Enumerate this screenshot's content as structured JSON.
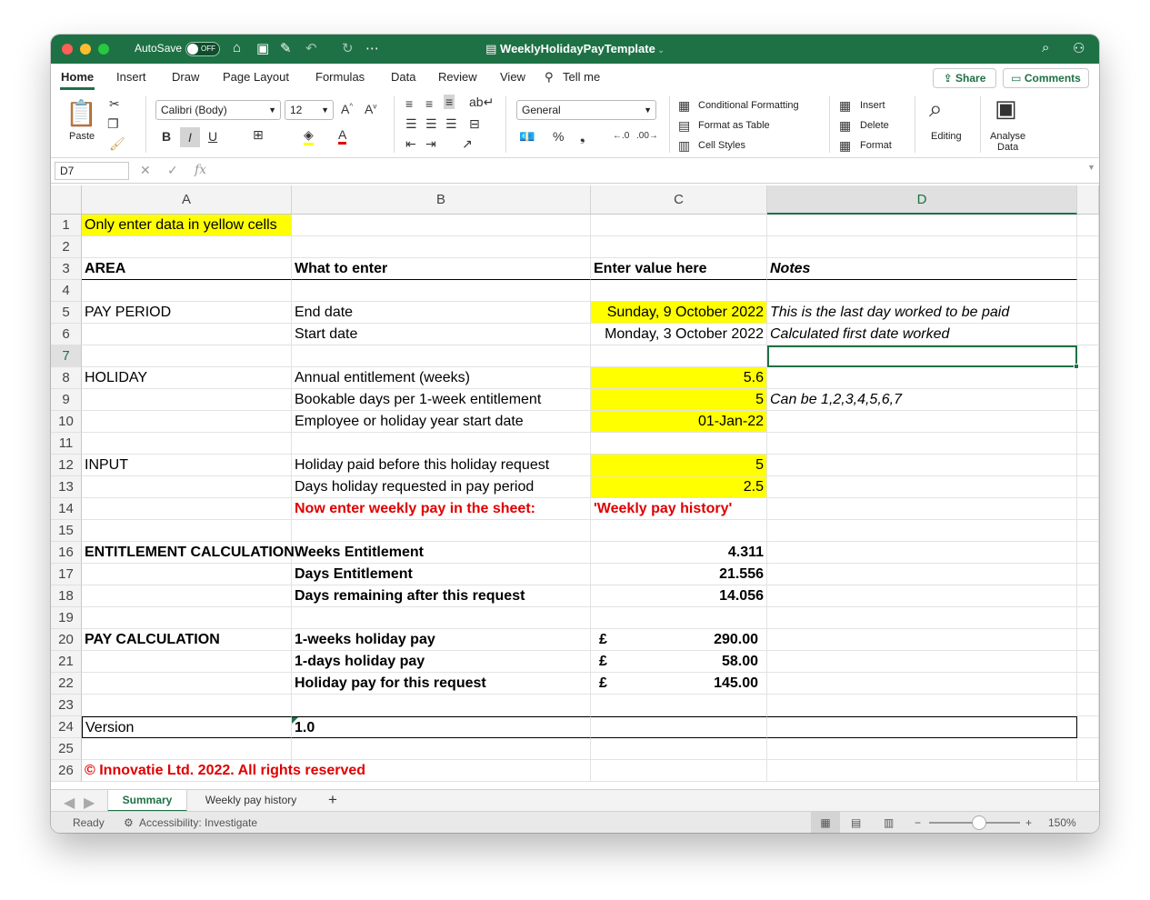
{
  "window": {
    "autosave_label": "AutoSave",
    "autosave_state": "OFF",
    "title": "WeeklyHolidayPayTemplate"
  },
  "tabs": [
    "Home",
    "Insert",
    "Draw",
    "Page Layout",
    "Formulas",
    "Data",
    "Review",
    "View",
    "Tell me"
  ],
  "buttons": {
    "share": "Share",
    "comments": "Comments"
  },
  "ribbon": {
    "paste": "Paste",
    "font_name": "Calibri (Body)",
    "font_size": "12",
    "number_format": "General",
    "conditional_formatting": "Conditional Formatting",
    "format_as_table": "Format as Table",
    "cell_styles": "Cell Styles",
    "insert": "Insert",
    "delete": "Delete",
    "format": "Format",
    "editing": "Editing",
    "analyse_data_1": "Analyse",
    "analyse_data_2": "Data"
  },
  "formula_bar": {
    "name_box": "D7",
    "fx": "fx",
    "formula": ""
  },
  "columns": [
    "A",
    "B",
    "C",
    "D"
  ],
  "rows": {
    "r1": {
      "num": "1",
      "A": "Only enter data in yellow cells"
    },
    "r2": {
      "num": "2"
    },
    "r3": {
      "num": "3",
      "A": "AREA",
      "B": "What to enter",
      "C": "Enter value here",
      "D": "Notes"
    },
    "r4": {
      "num": "4"
    },
    "r5": {
      "num": "5",
      "A": "PAY PERIOD",
      "B": "End date",
      "C": "Sunday, 9 October 2022",
      "D": "This is the last day worked to be paid"
    },
    "r6": {
      "num": "6",
      "B": "Start date",
      "C": "Monday, 3 October 2022",
      "D": "Calculated first date worked"
    },
    "r7": {
      "num": "7"
    },
    "r8": {
      "num": "8",
      "A": "HOLIDAY",
      "B": "Annual entitlement (weeks)",
      "C": "5.6"
    },
    "r9": {
      "num": "9",
      "B": "Bookable days per 1-week entitlement",
      "C": "5",
      "D": "Can be 1,2,3,4,5,6,7"
    },
    "r10": {
      "num": "10",
      "B": "Employee or holiday year start date",
      "C": "01-Jan-22"
    },
    "r11": {
      "num": "11"
    },
    "r12": {
      "num": "12",
      "A": "INPUT",
      "B": "Holiday paid before this holiday request",
      "C": "5"
    },
    "r13": {
      "num": "13",
      "B": "Days holiday requested in pay period",
      "C": "2.5"
    },
    "r14": {
      "num": "14",
      "B": "Now enter weekly pay in the sheet:",
      "C": "'Weekly pay history'"
    },
    "r15": {
      "num": "15"
    },
    "r16": {
      "num": "16",
      "A": "ENTITLEMENT CALCULATION",
      "B": "Weeks Entitlement",
      "C": "4.311"
    },
    "r17": {
      "num": "17",
      "B": "Days Entitlement",
      "C": "21.556"
    },
    "r18": {
      "num": "18",
      "B": "Days remaining after this request",
      "C": "14.056"
    },
    "r19": {
      "num": "19"
    },
    "r20": {
      "num": "20",
      "A": "PAY CALCULATION",
      "B": "1-weeks holiday pay",
      "C_cur": "£",
      "C": "290.00"
    },
    "r21": {
      "num": "21",
      "B": "1-days holiday pay",
      "C_cur": "£",
      "C": "58.00"
    },
    "r22": {
      "num": "22",
      "B": "Holiday pay for this request",
      "C_cur": "£",
      "C": "145.00"
    },
    "r23": {
      "num": "23"
    },
    "r24": {
      "num": "24",
      "A": "Version",
      "B": "1.0"
    },
    "r25": {
      "num": "25"
    },
    "r26": {
      "num": "26",
      "A": "© Innovatie Ltd. 2022. All rights reserved"
    }
  },
  "sheets": [
    "Summary",
    "Weekly pay history"
  ],
  "status": {
    "ready": "Ready",
    "accessibility": "Accessibility: Investigate",
    "zoom": "150%"
  },
  "colors": {
    "excel_green": "#1e7145",
    "yellow": "#ffff00",
    "red": "#e00000"
  }
}
